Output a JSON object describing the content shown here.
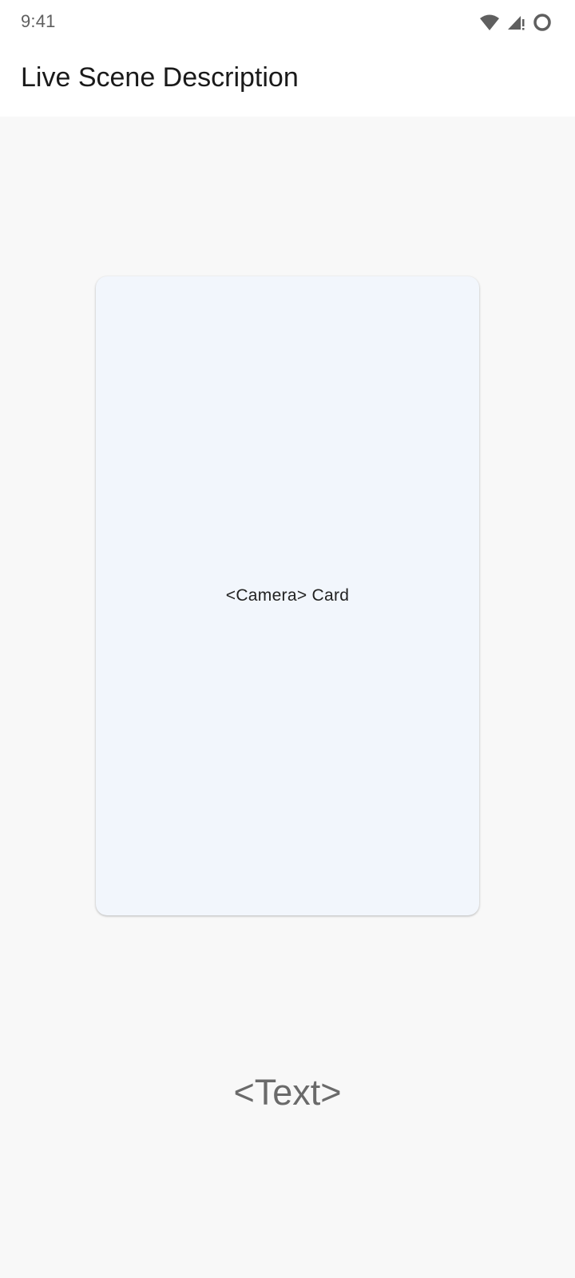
{
  "status_bar": {
    "time": "9:41",
    "icons": [
      "wifi-icon",
      "cellular-signal-icon",
      "battery-icon"
    ]
  },
  "app_bar": {
    "title": "Live Scene Description"
  },
  "camera_card": {
    "label": "<Camera> Card"
  },
  "scene_text": {
    "value": "<Text>"
  },
  "colors": {
    "background": "#f8f8f8",
    "app_bar": "#ffffff",
    "card_surface": "#f2f6fc",
    "scene_text": "#6a6a6a"
  }
}
